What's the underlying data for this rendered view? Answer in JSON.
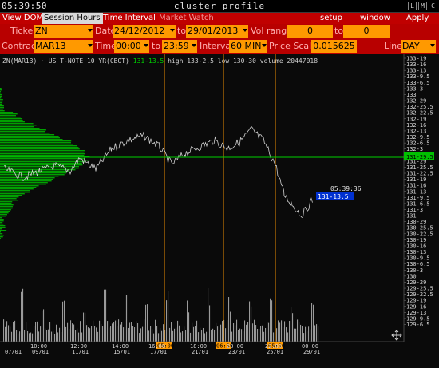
{
  "titlebar": {
    "clock": "05:39:50",
    "title": "cluster profile",
    "buttons": [
      "L",
      "M",
      "C"
    ]
  },
  "menu": {
    "view_dom": "View DOM",
    "session_hours": "Session Hours",
    "time_interval": "Time Interval",
    "market_watch": "Market Watch",
    "setup": "setup",
    "window": "window",
    "apply": "Apply"
  },
  "params": {
    "ticker_label": "Ticker",
    "ticker_value": "ZN",
    "date_label": "Date",
    "date_from": "24/12/2012",
    "to_label": "to",
    "date_to": "29/01/2013",
    "vol_range_label": "Vol range",
    "vol_from": "0",
    "vol_to_label": "to",
    "vol_to": "0",
    "contract_label": "Contract",
    "contract_value": "MAR13",
    "time_label": "Time",
    "time_from": "00:00",
    "time_to_label": "to",
    "time_to": "23:59",
    "interval_label": "Interval",
    "interval_value": "60 MIN",
    "price_scale_label": "Price Scale",
    "price_scale_value": "0.015625",
    "line_label": "Line",
    "line_value": "DAY"
  },
  "instrument": {
    "prefix": "ZN(MAR13) · US T-NOTE 10 YR(CBOT)",
    "last": "131-13.5",
    "high": "high 133-2.5",
    "low": "low 130-30",
    "volume": "volume 20447018"
  },
  "price_labels": [
    "133-19",
    "133-16",
    "133-13",
    "133-9.5",
    "133-6.5",
    "133-3",
    "133",
    "132-29",
    "132-25.5",
    "132-22.5",
    "132-19",
    "132-16",
    "132-13",
    "132-9.5",
    "132-6.5",
    "132-3",
    "132",
    "131-29",
    "131-25.5",
    "131-22.5",
    "131-19",
    "131-16",
    "131-13",
    "131-9.5",
    "131-6.5",
    "131-3",
    "131",
    "130-29",
    "130-25.5",
    "130-22.5",
    "130-19",
    "130-16",
    "130-13",
    "130-9.5",
    "130-6.5",
    "130-3",
    "130",
    "129-29",
    "129-25.5",
    "129-22.5",
    "129-19",
    "129-16",
    "129-13",
    "129-9.5",
    "129-6.5"
  ],
  "current_price_label": "131-29.5",
  "cursor": {
    "time": "05:39:36",
    "price": "131-13.5"
  },
  "x_axis": [
    {
      "time": "",
      "date": "07/01"
    },
    {
      "time": "10:00",
      "date": "09/01"
    },
    {
      "time": "12:00",
      "date": "11/01"
    },
    {
      "time": "14:00",
      "date": "15/01"
    },
    {
      "time": "16:00",
      "date": "17/01"
    },
    {
      "time": "18:00",
      "date": "21/01"
    },
    {
      "time": "20:00",
      "date": "23/01"
    },
    {
      "time": "22:00",
      "date": "25/01"
    },
    {
      "time": "00:00",
      "date": "29/01"
    }
  ],
  "session_markers": [
    "05:00",
    "06:00",
    "05:00"
  ],
  "colors": {
    "menu_red": "#c00000",
    "field_orange": "#ff9900",
    "profile_green": "#00c000",
    "current_line": "#00d000",
    "cursor_blue": "#0030d0",
    "session_line": "#ff9900"
  }
}
